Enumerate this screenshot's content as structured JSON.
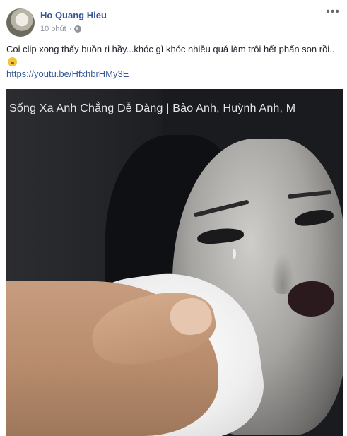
{
  "post": {
    "author": "Ho Quang Hieu",
    "time": "10 phút",
    "separator": "·",
    "privacy_icon": "globe-icon",
    "more_icon": "more-options-icon",
    "more_glyph": "•••",
    "text": "Coi clip xong thấy buồn ri hầy...khóc gì khóc nhiều quá làm trôi hết phấn son rồi..",
    "emoji_icon": "sad-emoji-icon",
    "link": "https://youtu.be/HfxhbrHMy3E",
    "media": {
      "caption": "Sống Xa Anh Chẳng Dễ Dàng | Bảo Anh, Huỳnh Anh, M"
    }
  },
  "colors": {
    "link": "#365899",
    "text": "#1d2129",
    "meta": "#90949c"
  }
}
